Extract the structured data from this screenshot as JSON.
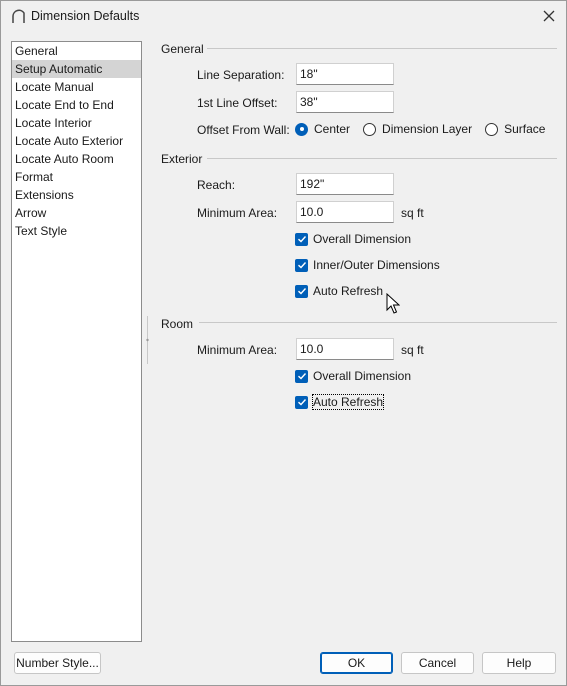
{
  "window": {
    "title": "Dimension Defaults"
  },
  "sidebar": {
    "items": [
      {
        "label": "General",
        "selected": false
      },
      {
        "label": "Setup Automatic",
        "selected": true
      },
      {
        "label": "Locate Manual",
        "selected": false
      },
      {
        "label": "Locate End to End",
        "selected": false
      },
      {
        "label": "Locate Interior",
        "selected": false
      },
      {
        "label": "Locate Auto Exterior",
        "selected": false
      },
      {
        "label": "Locate Auto Room",
        "selected": false
      },
      {
        "label": "Format",
        "selected": false
      },
      {
        "label": "Extensions",
        "selected": false
      },
      {
        "label": "Arrow",
        "selected": false
      },
      {
        "label": "Text Style",
        "selected": false
      }
    ]
  },
  "general": {
    "heading": "General",
    "line_separation_label": "Line Separation:",
    "line_separation_value": "18\"",
    "first_line_offset_label": "1st Line Offset:",
    "first_line_offset_value": "38\"",
    "offset_from_wall_label": "Offset From Wall:",
    "offset_options": [
      {
        "label": "Center",
        "checked": true
      },
      {
        "label": "Dimension Layer",
        "checked": false
      },
      {
        "label": "Surface",
        "checked": false
      }
    ]
  },
  "exterior": {
    "heading": "Exterior",
    "reach_label": "Reach:",
    "reach_value": "192\"",
    "min_area_label": "Minimum Area:",
    "min_area_value": "10.0",
    "min_area_unit": "sq ft",
    "overall_dimension": "Overall Dimension",
    "inner_outer": "Inner/Outer Dimensions",
    "auto_refresh": "Auto Refresh"
  },
  "room": {
    "heading": "Room",
    "min_area_label": "Minimum Area:",
    "min_area_value": "10.0",
    "min_area_unit": "sq ft",
    "overall_dimension": "Overall Dimension",
    "auto_refresh": "Auto Refresh"
  },
  "buttons": {
    "number_style": "Number Style...",
    "ok": "OK",
    "cancel": "Cancel",
    "help": "Help"
  },
  "colors": {
    "accent": "#005fb8",
    "selection": "#d4d4d4"
  }
}
